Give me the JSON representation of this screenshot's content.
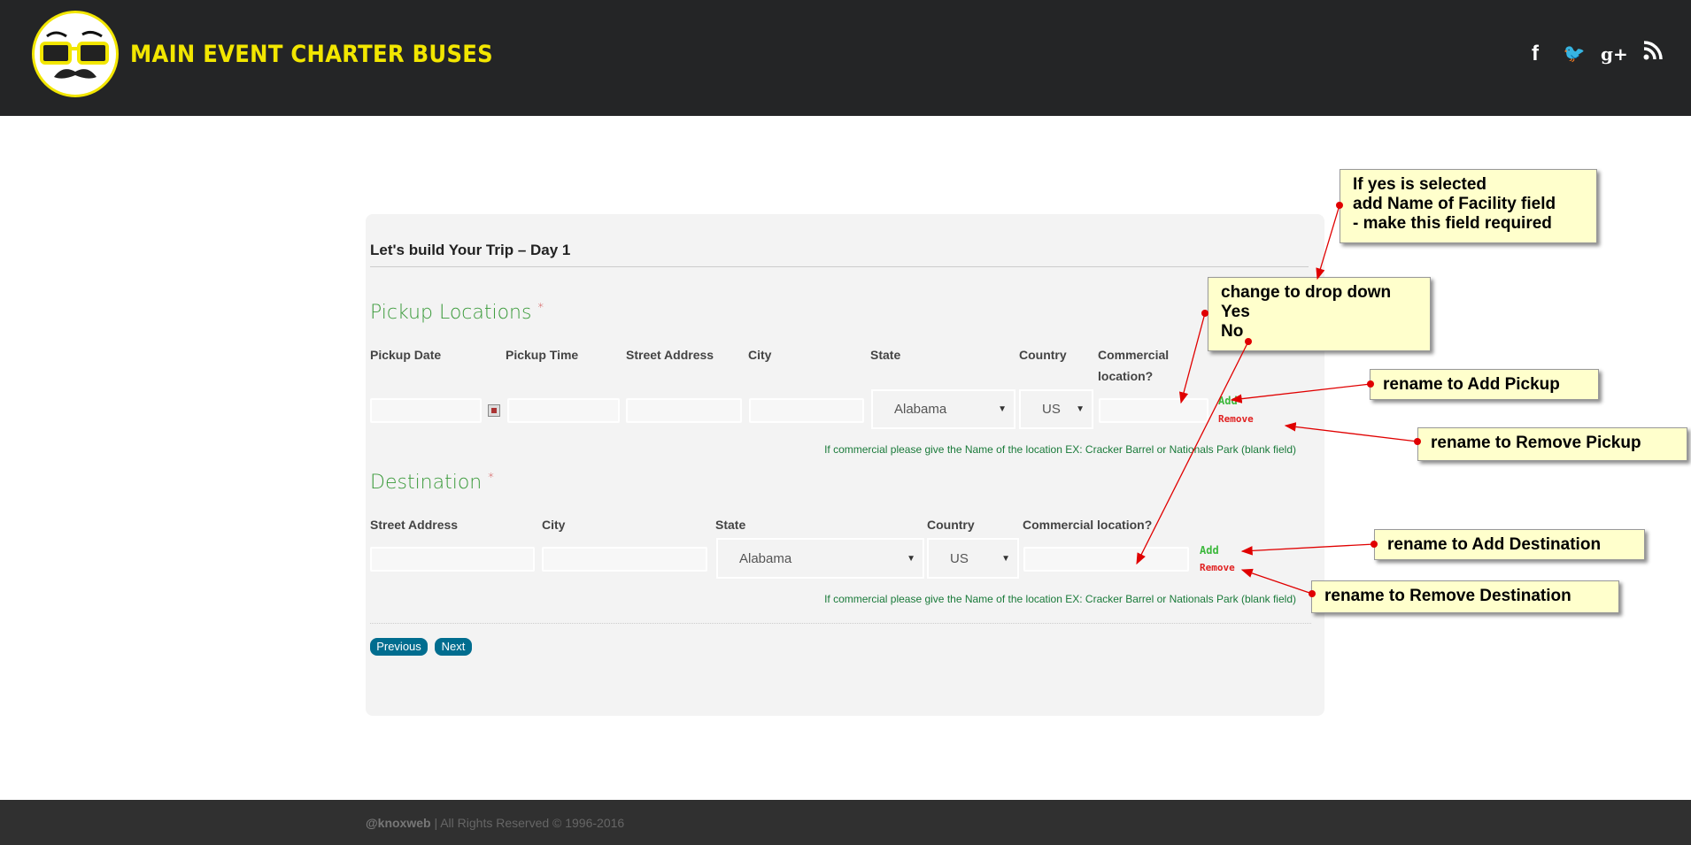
{
  "header": {
    "title": "MAIN EVENT CHARTER BUSES",
    "logo": "mustache-glasses-face-logo",
    "social": [
      {
        "icon": "facebook-icon",
        "glyph": "f"
      },
      {
        "icon": "twitter-icon",
        "glyph": "🐦"
      },
      {
        "icon": "google-plus-icon",
        "glyph": "g+"
      },
      {
        "icon": "rss-icon",
        "glyph": "◥"
      }
    ]
  },
  "form": {
    "title": "Let's build Your Trip – Day 1",
    "pickup": {
      "heading": "Pickup Locations",
      "required": "*",
      "labels": {
        "date": "Pickup Date",
        "time": "Pickup Time",
        "street": "Street Address",
        "city": "City",
        "state": "State",
        "country": "Country",
        "commercial_1": "Commercial",
        "commercial_2": "location?"
      },
      "state_value": "Alabama",
      "country_value": "US",
      "add": "Add",
      "remove": "Remove",
      "hint": "If commercial please give the Name of the location EX: Cracker Barrel or Nationals Park (blank field)"
    },
    "destination": {
      "heading": "Destination",
      "required": "*",
      "labels": {
        "street": "Street Address",
        "city": "City",
        "state": "State",
        "country": "Country",
        "commercial": "Commercial location?"
      },
      "state_value": "Alabama",
      "country_value": "US",
      "add": "Add",
      "remove": "Remove",
      "hint": "If commercial please give the Name of the location EX: Cracker Barrel or Nationals Park (blank field)"
    },
    "buttons": {
      "previous": "Previous",
      "next": "Next"
    }
  },
  "footer": {
    "brand": "@knoxweb",
    "text": " | All Rights Reserved © 1996-2016"
  },
  "annotations": {
    "facility": [
      "If yes is selected",
      "add Name of Facility field",
      "- make this field required"
    ],
    "dropdown": [
      "change to drop down",
      "Yes",
      "No"
    ],
    "add_pickup": "rename to Add Pickup",
    "remove_pickup": "rename to Remove Pickup",
    "add_destination": "rename to Add Destination",
    "remove_destination": "rename to Remove Destination"
  },
  "colors": {
    "header": "#242526",
    "title": "#f2e600",
    "section": "#3a9a3a",
    "button": "#006d8f",
    "note": "#ffffcc",
    "arrow": "#e00000"
  }
}
